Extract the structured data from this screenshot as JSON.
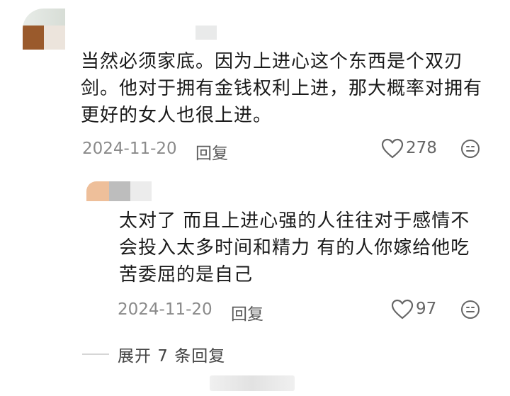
{
  "comment": {
    "text": "当然必须家底。因为上进心这个东西是个双刃剑。他对于拥有金钱权利上进，那大概率对拥有更好的女人也很上进。",
    "date": "2024-11-20",
    "reply_label": "回复",
    "like_count": "278"
  },
  "reply": {
    "text": "太对了 而且上进心强的人往往对于感情不会投入太多时间和精力 有的人你嫁给他吃苦委屈的是自己",
    "date": "2024-11-20",
    "reply_label": "回复",
    "like_count": "97"
  },
  "expand": {
    "label": "展开 7 条回复"
  },
  "icons": {
    "like": "heart-outline-icon",
    "emoji": "smiley-icon"
  }
}
